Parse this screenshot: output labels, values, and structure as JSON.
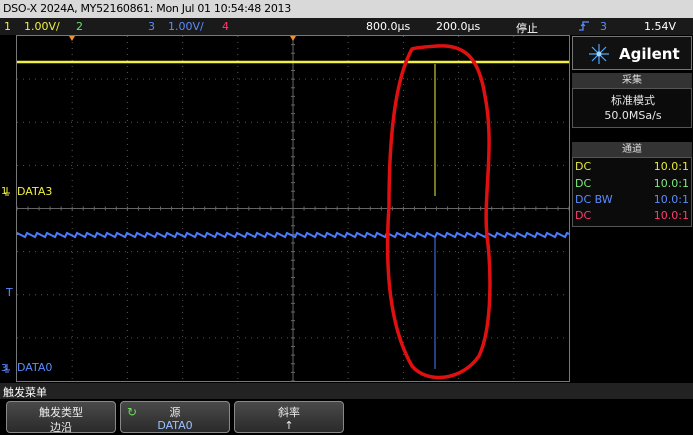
{
  "title": "DSO-X 2024A, MY52160861: Mon Jul 01 10:54:48 2013",
  "status": {
    "ch1_num": "1",
    "ch1_scale": "1.00V/",
    "ch2_num": "2",
    "ch3_num": "3",
    "ch3_scale": "1.00V/",
    "ch4_num": "4",
    "timebase": "800.0µs",
    "delay": "200.0µs",
    "run_state": "停止",
    "trig_icon": "trigger-edge-icon",
    "trig_src": "3",
    "trig_level": "1.54V"
  },
  "screen": {
    "ch1_label": "DATA3",
    "ch1_marker": "1",
    "ch3_label": "DATA0",
    "ch3_marker": "3",
    "trig_marker": "T"
  },
  "panel": {
    "brand": "Agilent",
    "acq_header": "采集",
    "acq_mode": "标准模式",
    "acq_rate": "50.0MSa/s",
    "chan_header": "通道",
    "channels": [
      {
        "coupling": "DC",
        "probe": "10.0:1",
        "color": "#e8e83a"
      },
      {
        "coupling": "DC",
        "probe": "10.0:1",
        "color": "#7ee87e"
      },
      {
        "coupling": "DC BW",
        "probe": "10.0:1",
        "color": "#5a8cff"
      },
      {
        "coupling": "DC",
        "probe": "10.0:1",
        "color": "#ff3a6e"
      }
    ]
  },
  "menu": {
    "title": "触发菜单",
    "keys": [
      {
        "top": "触发类型",
        "bottom": "边沿"
      },
      {
        "top": "源",
        "bottom": "DATA0"
      },
      {
        "top": "斜率",
        "bottom": "↑"
      }
    ]
  },
  "colors": {
    "ch1": "#f0f040",
    "ch2": "#6ee06e",
    "ch3": "#4a7cff",
    "ch4": "#ff3a6e",
    "annotation": "#e01010",
    "trigger": "#f09030"
  }
}
